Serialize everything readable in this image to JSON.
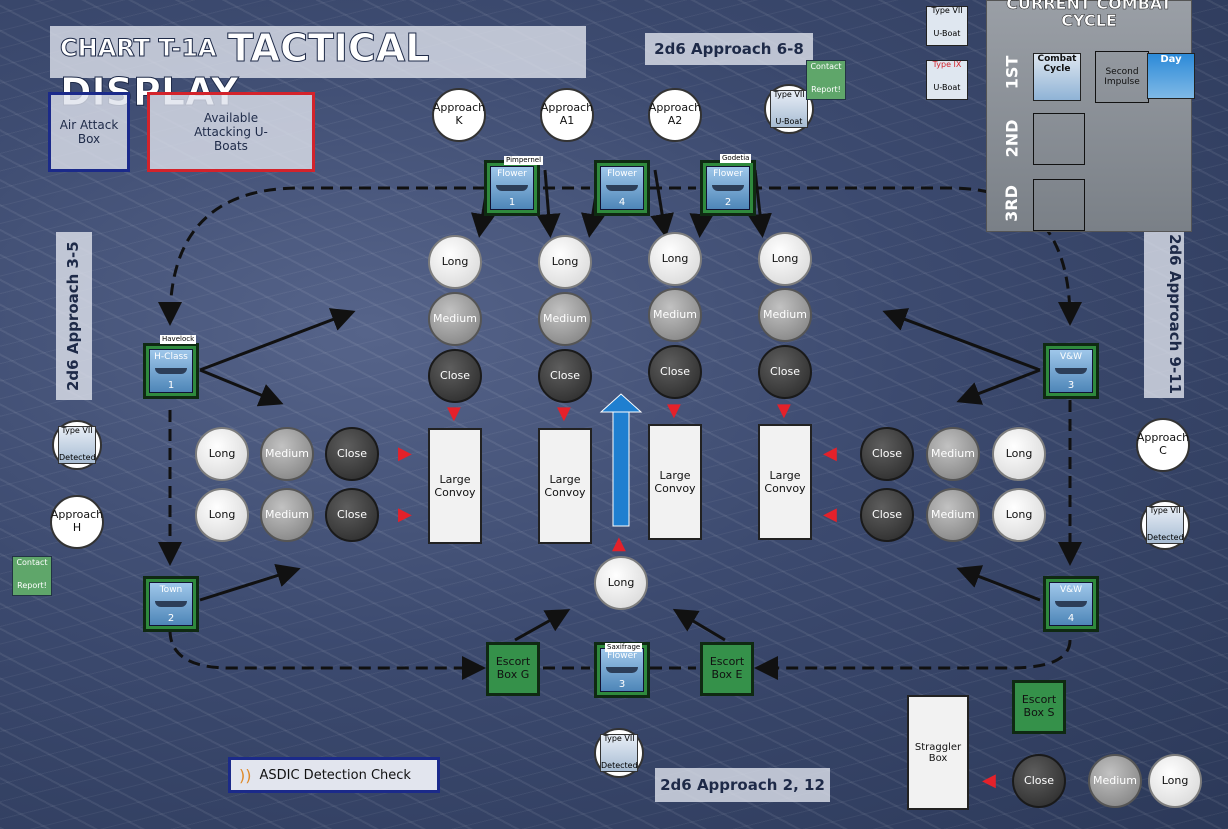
{
  "title": {
    "part1": "CHART T-1A",
    "part2": "TACTICAL DISPLAY"
  },
  "boxes": {
    "air": "Air Attack Box",
    "uboats": "Available Attacking U-Boats",
    "straggler": "Straggler Box"
  },
  "approach_labels": {
    "top": "2d6 Approach 6-8",
    "left": "2d6 Approach 3-5",
    "right": "2d6 Approach 9-11",
    "bottom": "2d6 Approach 2, 12"
  },
  "approach_circles": {
    "k": "Approach K",
    "a1": "Approach A1",
    "a2": "Approach A2",
    "c": "Approach C",
    "h": "Approach H"
  },
  "range": {
    "long": "Long",
    "medium": "Medium",
    "close": "Close"
  },
  "convoy_label": "Large Convoy",
  "ships": {
    "t1": {
      "name": "Flower",
      "num": "1",
      "tag": "Pimpernel"
    },
    "t2": {
      "name": "Flower",
      "num": "4",
      "tag": ""
    },
    "t3": {
      "name": "Flower",
      "num": "2",
      "tag": "Godetia"
    },
    "l1": {
      "name": "H-Class",
      "num": "1",
      "tag": "Havelock"
    },
    "l2": {
      "name": "Town",
      "num": "2",
      "tag": ""
    },
    "r3": {
      "name": "V&W",
      "num": "3",
      "tag": ""
    },
    "r4": {
      "name": "V&W",
      "num": "4",
      "tag": ""
    },
    "b3": {
      "name": "Flower",
      "num": "3",
      "tag": "Saxifrage"
    }
  },
  "escort_boxes": {
    "g": "Escort Box G",
    "e": "Escort Box E",
    "s": "Escort Box S"
  },
  "tokens": {
    "type_vii": "Type VII",
    "type_ix": "Type IX",
    "uboat": "U-Boat",
    "detected": "Detected",
    "contact": "Contact",
    "report": "Report!"
  },
  "cycle": {
    "title": "CURRENT COMBAT CYCLE",
    "row1": "1ST",
    "row2": "2ND",
    "row3": "3RD",
    "combat_cycle": "Combat Cycle",
    "second_impulse": "Second Impulse",
    "day": "Day"
  },
  "asdic": "ASDIC Detection Check"
}
